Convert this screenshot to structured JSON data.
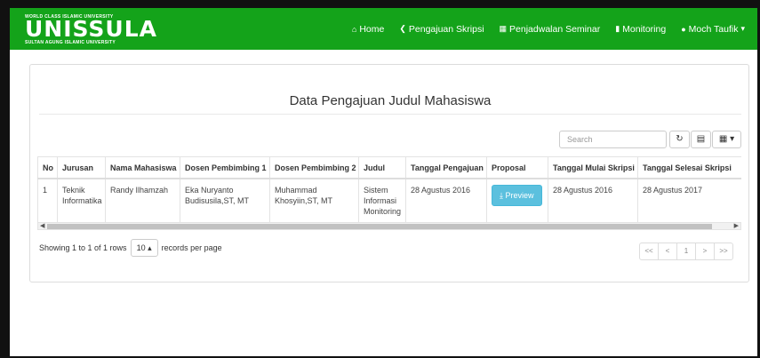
{
  "brand": {
    "tagline_top": "WORLD CLASS ISLAMIC UNIVERSITY",
    "name": "UNISSULA",
    "tagline_bottom": "SULTAN AGUNG ISLAMIC UNIVERSITY"
  },
  "nav": {
    "home": "Home",
    "pengajuan": "Pengajuan Skripsi",
    "penjadwalan": "Penjadwalan Seminar",
    "monitoring": "Monitoring",
    "user": "Moch Taufik"
  },
  "page": {
    "title": "Data Pengajuan Judul Mahasiswa"
  },
  "toolbar": {
    "search_placeholder": "Search"
  },
  "table": {
    "headers": [
      "No",
      "Jurusan",
      "Nama Mahasiswa",
      "Dosen Pembimbing 1",
      "Dosen Pembimbing 2",
      "Judul",
      "Tanggal Pengajuan",
      "Proposal",
      "Tanggal Mulai Skripsi",
      "Tanggal Selesai Skripsi"
    ],
    "rows": [
      {
        "no": "1",
        "jurusan": "Teknik Informatika",
        "nama": "Randy Ilhamzah",
        "dosen1": "Eka Nuryanto Budisusila,ST, MT",
        "dosen2": "Muhammad Khosyiin,ST, MT",
        "judul": "Sistem Informasi Monitoring",
        "tanggal_pengajuan": "28 Agustus 2016",
        "proposal_button": "Preview",
        "tanggal_mulai": "28 Agustus 2016",
        "tanggal_selesai": "28 Agustus 2017"
      }
    ]
  },
  "footer": {
    "showing": "Showing 1 to 1 of 1 rows",
    "page_size": "10",
    "records_per_page": "records per page"
  },
  "pagination": {
    "first": "<<",
    "prev": "<",
    "current": "1",
    "next": ">",
    "last": ">>"
  },
  "colors": {
    "navbar": "#14a31a",
    "preview_button": "#5bc0de"
  }
}
